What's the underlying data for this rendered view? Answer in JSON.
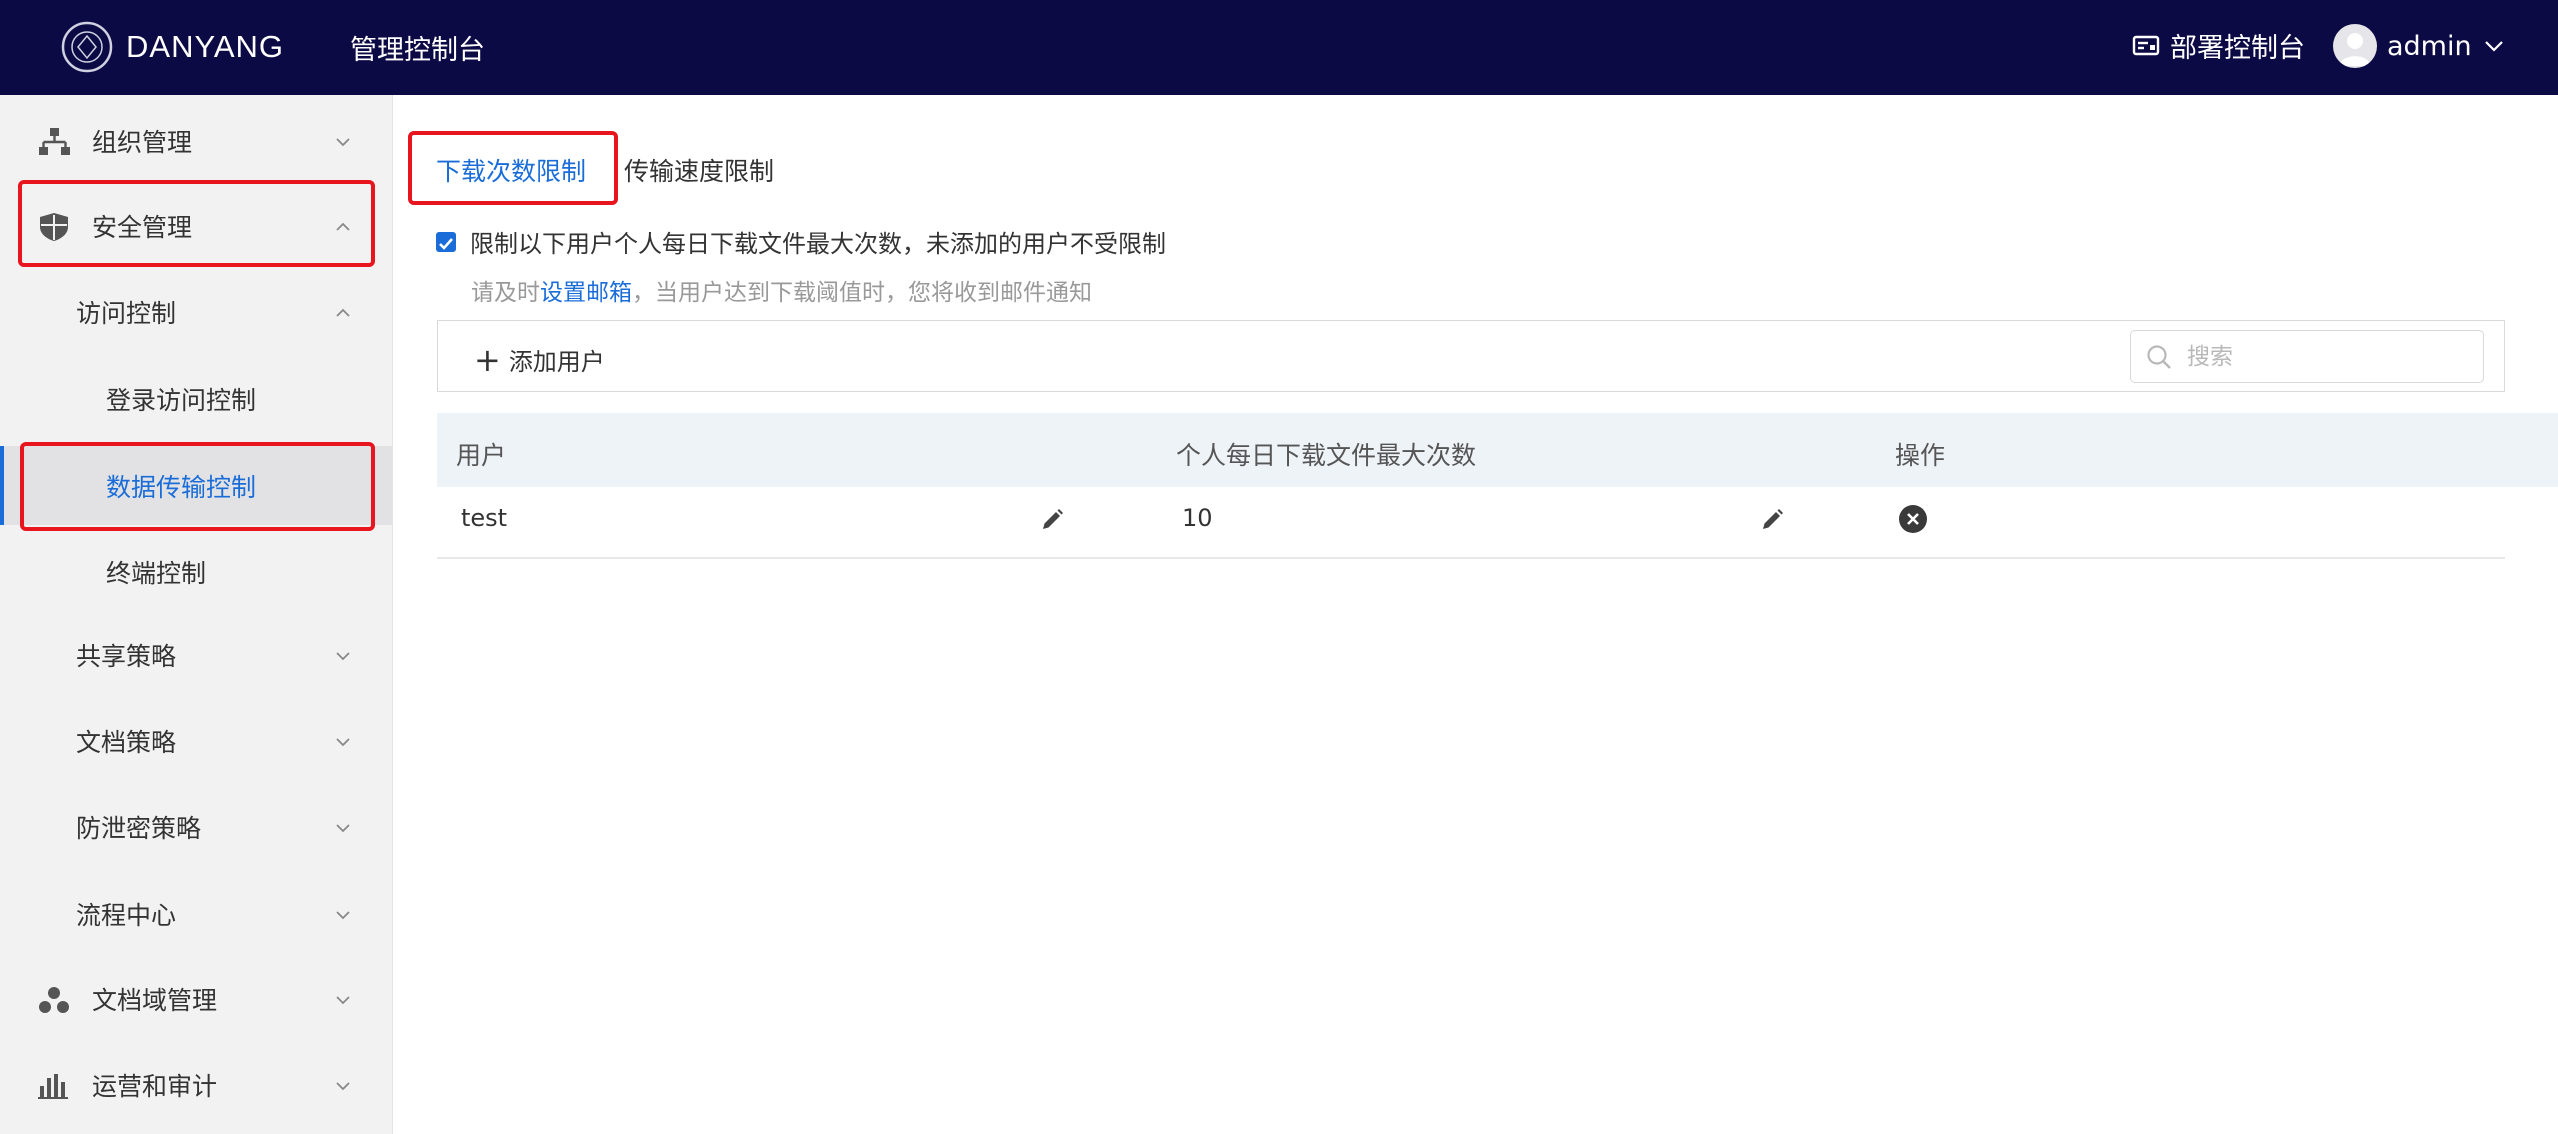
{
  "header": {
    "brand": "DANYANG",
    "console_title": "管理控制台",
    "deploy_label": "部署控制台",
    "username": "admin",
    "background_color": "#0c0a45"
  },
  "sidebar": {
    "items": [
      {
        "label": "组织管理",
        "icon": "org-tree-icon",
        "expanded": false
      },
      {
        "label": "安全管理",
        "icon": "shield-icon",
        "expanded": true
      },
      {
        "label": "访问控制",
        "expanded": true
      },
      {
        "label": "登录访问控制"
      },
      {
        "label": "数据传输控制",
        "selected": true
      },
      {
        "label": "终端控制"
      },
      {
        "label": "共享策略",
        "expanded": false
      },
      {
        "label": "文档策略",
        "expanded": false
      },
      {
        "label": "防泄密策略",
        "expanded": false
      },
      {
        "label": "流程中心",
        "expanded": false
      },
      {
        "label": "文档域管理",
        "icon": "domain-nodes-icon",
        "expanded": false
      },
      {
        "label": "运营和审计",
        "icon": "bar-chart-icon",
        "expanded": false
      }
    ]
  },
  "tabs": [
    {
      "label": "下载次数限制",
      "active": true
    },
    {
      "label": "传输速度限制",
      "active": false
    }
  ],
  "limit": {
    "checked": true,
    "label": "限制以下用户个人每日下载文件最大次数，未添加的用户不受限制",
    "hint_prefix": "请及时",
    "hint_link": "设置邮箱",
    "hint_suffix": "，当用户达到下载阈值时，您将收到邮件通知"
  },
  "toolbar": {
    "add_user_label": "添加用户",
    "search_placeholder": "搜索"
  },
  "table": {
    "columns": [
      "用户",
      "个人每日下载文件最大次数",
      "操作"
    ],
    "rows": [
      {
        "user": "test",
        "max_downloads": "10"
      }
    ]
  },
  "colors": {
    "accent": "#1a6dd8",
    "highlight_box": "#e8141e"
  }
}
